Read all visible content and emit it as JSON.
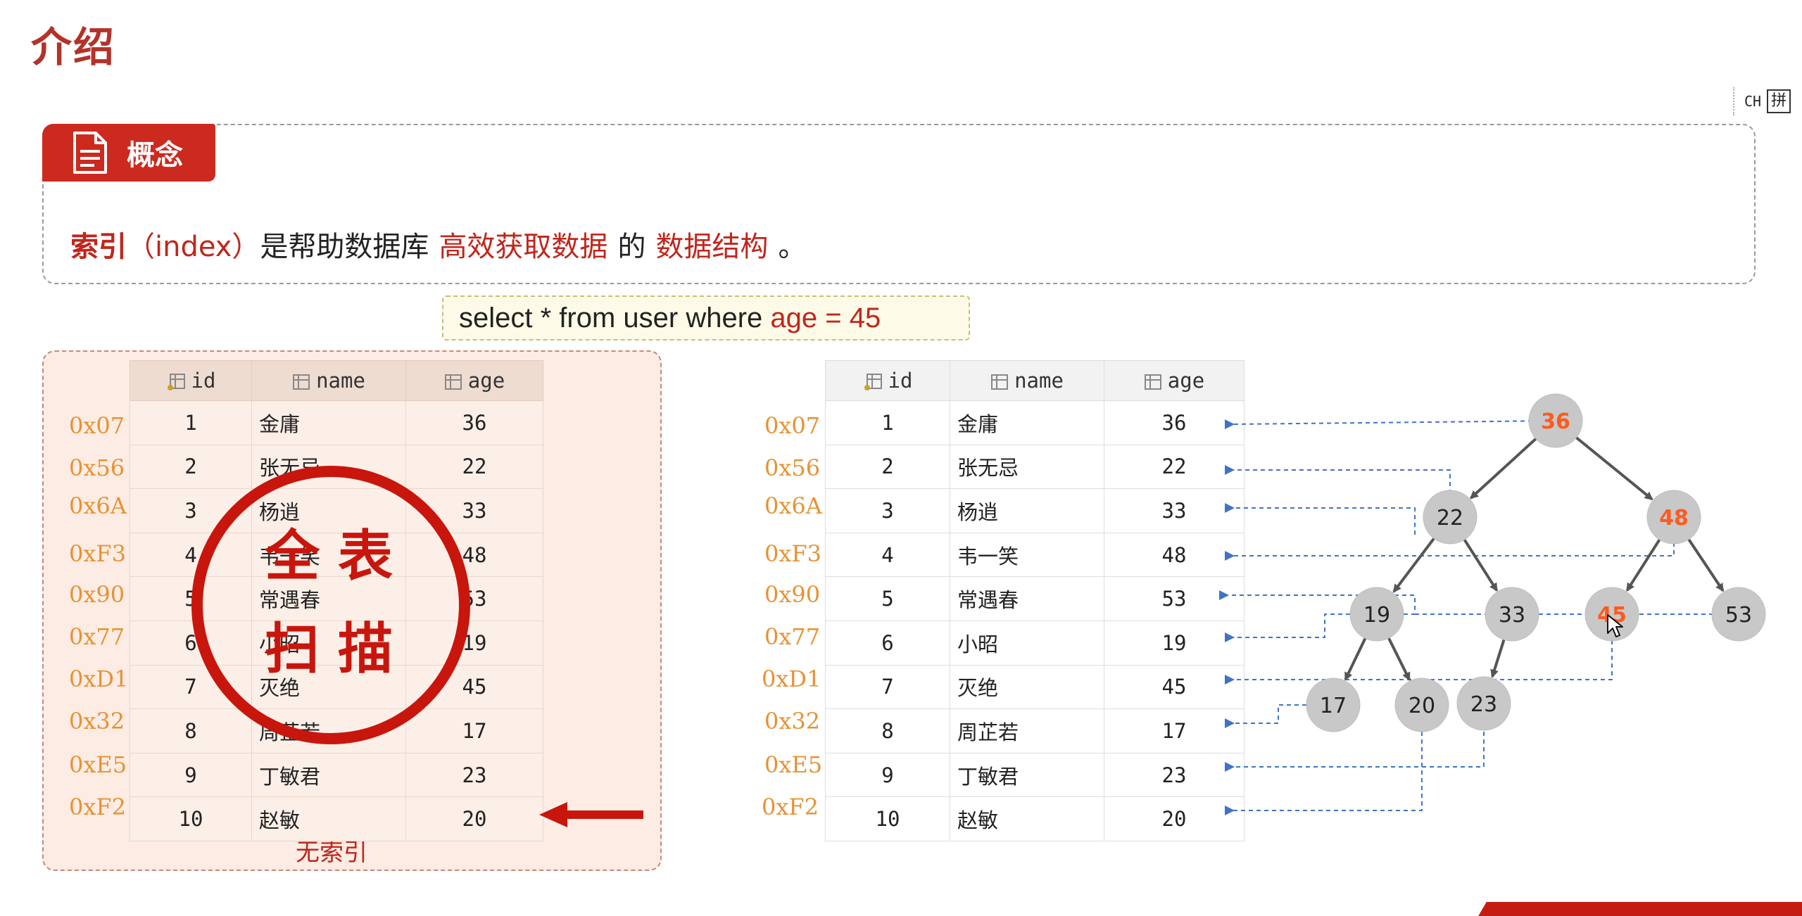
{
  "page": {
    "title": "介绍"
  },
  "ime": {
    "mode": "CH",
    "layout": "拼"
  },
  "concept": {
    "tab_label": "概念",
    "sentence": {
      "term": "索引",
      "paren": "（index）",
      "mid": "是帮助数据库",
      "highlight1": "高效获取数据",
      "connector": "的",
      "highlight2": "数据结构",
      "end": "。"
    }
  },
  "sql": {
    "prefix": "select * from user where ",
    "condition": "age = 45"
  },
  "columns": [
    "id",
    "name",
    "age"
  ],
  "rows": [
    {
      "addr": "0x07",
      "id": "1",
      "name": "金庸",
      "age": "36"
    },
    {
      "addr": "0x56",
      "id": "2",
      "name": "张无忌",
      "age": "22"
    },
    {
      "addr": "0x6A",
      "id": "3",
      "name": "杨逍",
      "age": "33"
    },
    {
      "addr": "0xF3",
      "id": "4",
      "name": "韦一笑",
      "age": "48"
    },
    {
      "addr": "0x90",
      "id": "5",
      "name": "常遇春",
      "age": "53"
    },
    {
      "addr": "0x77",
      "id": "6",
      "name": "小昭",
      "age": "19"
    },
    {
      "addr": "0xD1",
      "id": "7",
      "name": "灭绝",
      "age": "45"
    },
    {
      "addr": "0x32",
      "id": "8",
      "name": "周芷若",
      "age": "17"
    },
    {
      "addr": "0xE5",
      "id": "9",
      "name": "丁敏君",
      "age": "23"
    },
    {
      "addr": "0xF2",
      "id": "10",
      "name": "赵敏",
      "age": "20"
    }
  ],
  "left_panel": {
    "caption": "无索引",
    "stamp_line1": "全表",
    "stamp_line2": "扫描"
  },
  "tree": {
    "highlight_color": "#ff5a1e",
    "node_color": "#c8c8c8",
    "nodes": [
      {
        "key": "36",
        "highlight": true
      },
      {
        "key": "22",
        "highlight": false
      },
      {
        "key": "48",
        "highlight": true
      },
      {
        "key": "19",
        "highlight": false
      },
      {
        "key": "33",
        "highlight": false
      },
      {
        "key": "45",
        "highlight": true
      },
      {
        "key": "53",
        "highlight": false
      },
      {
        "key": "17",
        "highlight": false
      },
      {
        "key": "20",
        "highlight": false
      },
      {
        "key": "23",
        "highlight": false
      }
    ]
  },
  "colors": {
    "brand_red": "#cc2a1f",
    "addr_orange": "#e79233",
    "pointer_blue": "#3f73c9"
  }
}
